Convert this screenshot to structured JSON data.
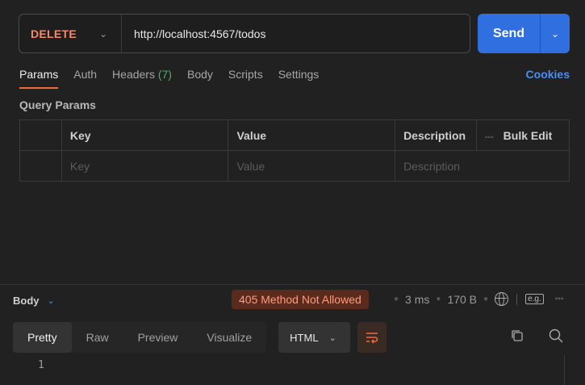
{
  "request": {
    "method": "DELETE",
    "url": "http://localhost:4567/todos",
    "send_label": "Send"
  },
  "tabs": [
    {
      "label": "Params"
    },
    {
      "label": "Auth"
    },
    {
      "label": "Headers",
      "count": "(7)"
    },
    {
      "label": "Body"
    },
    {
      "label": "Scripts"
    },
    {
      "label": "Settings"
    }
  ],
  "cookies_label": "Cookies",
  "query_params": {
    "title": "Query Params",
    "columns": [
      "Key",
      "Value",
      "Description"
    ],
    "bulk_edit": "Bulk Edit",
    "placeholders": {
      "key": "Key",
      "value": "Value",
      "description": "Description"
    }
  },
  "response": {
    "body_label": "Body",
    "status": "405 Method Not Allowed",
    "time": "3 ms",
    "size": "170 B",
    "tabs": [
      "Pretty",
      "Raw",
      "Preview",
      "Visualize"
    ],
    "format": "HTML",
    "line_number": "1",
    "eg_label": "e.g."
  },
  "colors": {
    "method": "#f08a6a",
    "send": "#2f6fe0",
    "status_bg": "#5a2a1d",
    "status_text": "#ff9b7a",
    "active_tab_underline": "#f06b3c",
    "cookies": "#4d8ef0"
  }
}
